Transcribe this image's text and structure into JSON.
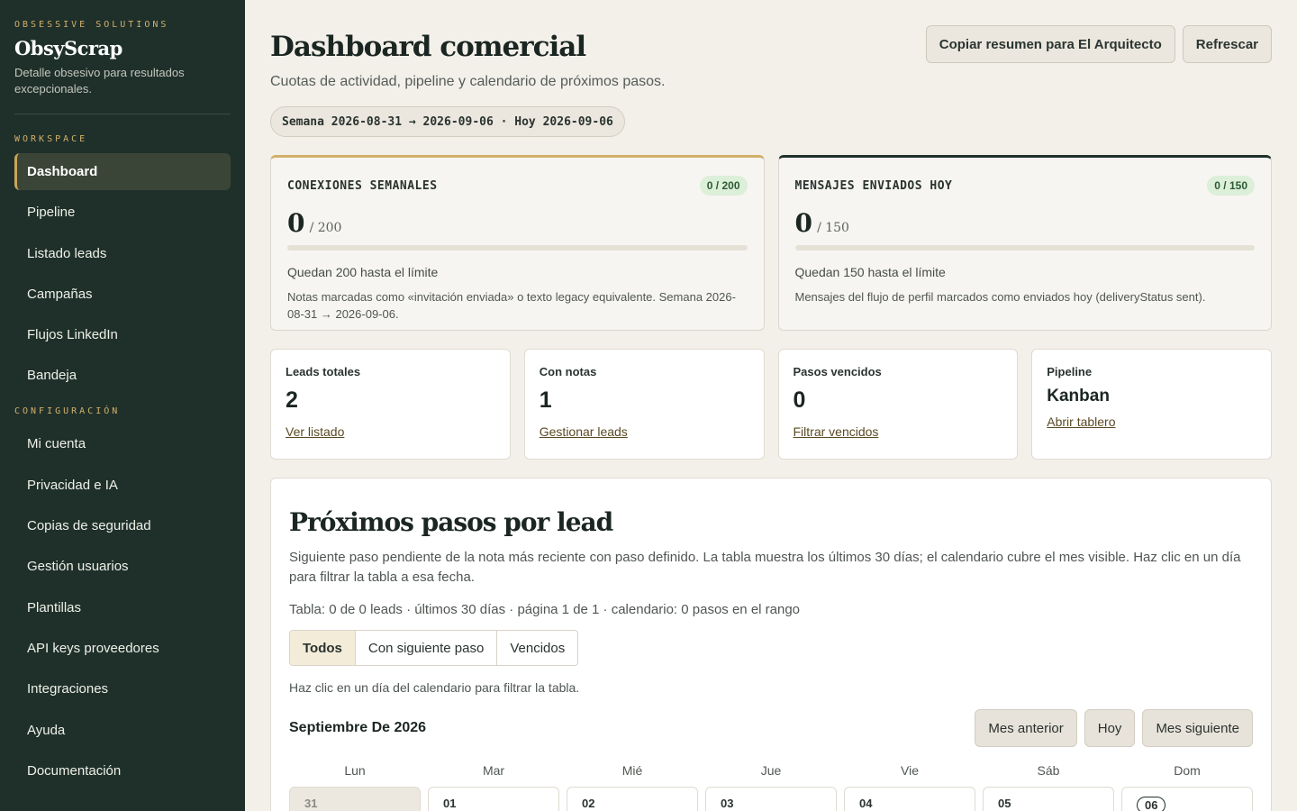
{
  "sidebar": {
    "eyebrow": "OBSESSIVE SOLUTIONS",
    "brand": "ObsyScrap",
    "tagline": "Detalle obsesivo para resultados excepcionales.",
    "workspace_label": "WORKSPACE",
    "workspace_items": [
      {
        "label": "Dashboard",
        "active": true
      },
      {
        "label": "Pipeline"
      },
      {
        "label": "Listado leads"
      },
      {
        "label": "Campañas"
      },
      {
        "label": "Flujos LinkedIn"
      },
      {
        "label": "Bandeja"
      }
    ],
    "config_label": "CONFIGURACIÓN",
    "config_items": [
      {
        "label": "Mi cuenta"
      },
      {
        "label": "Privacidad e IA"
      },
      {
        "label": "Copias de seguridad"
      },
      {
        "label": "Gestión usuarios"
      },
      {
        "label": "Plantillas"
      },
      {
        "label": "API keys proveedores"
      },
      {
        "label": "Integraciones"
      },
      {
        "label": "Ayuda"
      },
      {
        "label": "Documentación"
      }
    ]
  },
  "header": {
    "title": "Dashboard comercial",
    "subtitle": "Cuotas de actividad, pipeline y calendario de próximos pasos.",
    "week_pill": "Semana 2026-08-31 → 2026-09-06 · Hoy 2026-09-06",
    "copy_button": "Copiar resumen para El Arquitecto",
    "refresh_button": "Refrescar"
  },
  "quotas": [
    {
      "label": "CONEXIONES SEMANALES",
      "badge": "0 / 200",
      "value": "0",
      "limit_text": "/ 200",
      "progress": 0,
      "remaining": "Quedan 200 hasta el límite",
      "note": "Notas marcadas como «invitación enviada» o texto legacy equivalente. Semana 2026-08-31 → 2026-09-06."
    },
    {
      "label": "MENSAJES ENVIADOS HOY",
      "badge": "0 / 150",
      "value": "0",
      "limit_text": "/ 150",
      "progress": 0,
      "remaining": "Quedan 150 hasta el límite",
      "note": "Mensajes del flujo de perfil marcados como enviados hoy (deliveryStatus sent)."
    }
  ],
  "stats": [
    {
      "label": "Leads totales",
      "value": "2",
      "link": "Ver listado"
    },
    {
      "label": "Con notas",
      "value": "1",
      "link": "Gestionar leads"
    },
    {
      "label": "Pasos vencidos",
      "value": "0",
      "link": "Filtrar vencidos"
    },
    {
      "label": "Pipeline",
      "value": "Kanban",
      "link": "Abrir tablero"
    }
  ],
  "next_steps": {
    "title": "Próximos pasos por lead",
    "description": "Siguiente paso pendiente de la nota más reciente con paso definido. La tabla muestra los últimos 30 días; el calendario cubre el mes visible. Haz clic en un día para filtrar la tabla a esa fecha.",
    "meta": "Tabla: 0 de 0 leads · últimos 30 días · página 1 de 1 · calendario: 0 pasos en el rango",
    "filters": [
      {
        "label": "Todos",
        "active": true
      },
      {
        "label": "Con siguiente paso"
      },
      {
        "label": "Vencidos"
      }
    ],
    "hint": "Haz clic en un día del calendario para filtrar la tabla.",
    "month": "Septiembre De 2026",
    "prev_month": "Mes anterior",
    "today": "Hoy",
    "next_month": "Mes siguiente",
    "weekdays": [
      "Lun",
      "Mar",
      "Mié",
      "Jue",
      "Vie",
      "Sáb",
      "Dom"
    ],
    "first_week": [
      {
        "day": "31",
        "muted": true
      },
      {
        "day": "01"
      },
      {
        "day": "02"
      },
      {
        "day": "03"
      },
      {
        "day": "04"
      },
      {
        "day": "05"
      },
      {
        "day": "06",
        "today": true
      }
    ]
  }
}
